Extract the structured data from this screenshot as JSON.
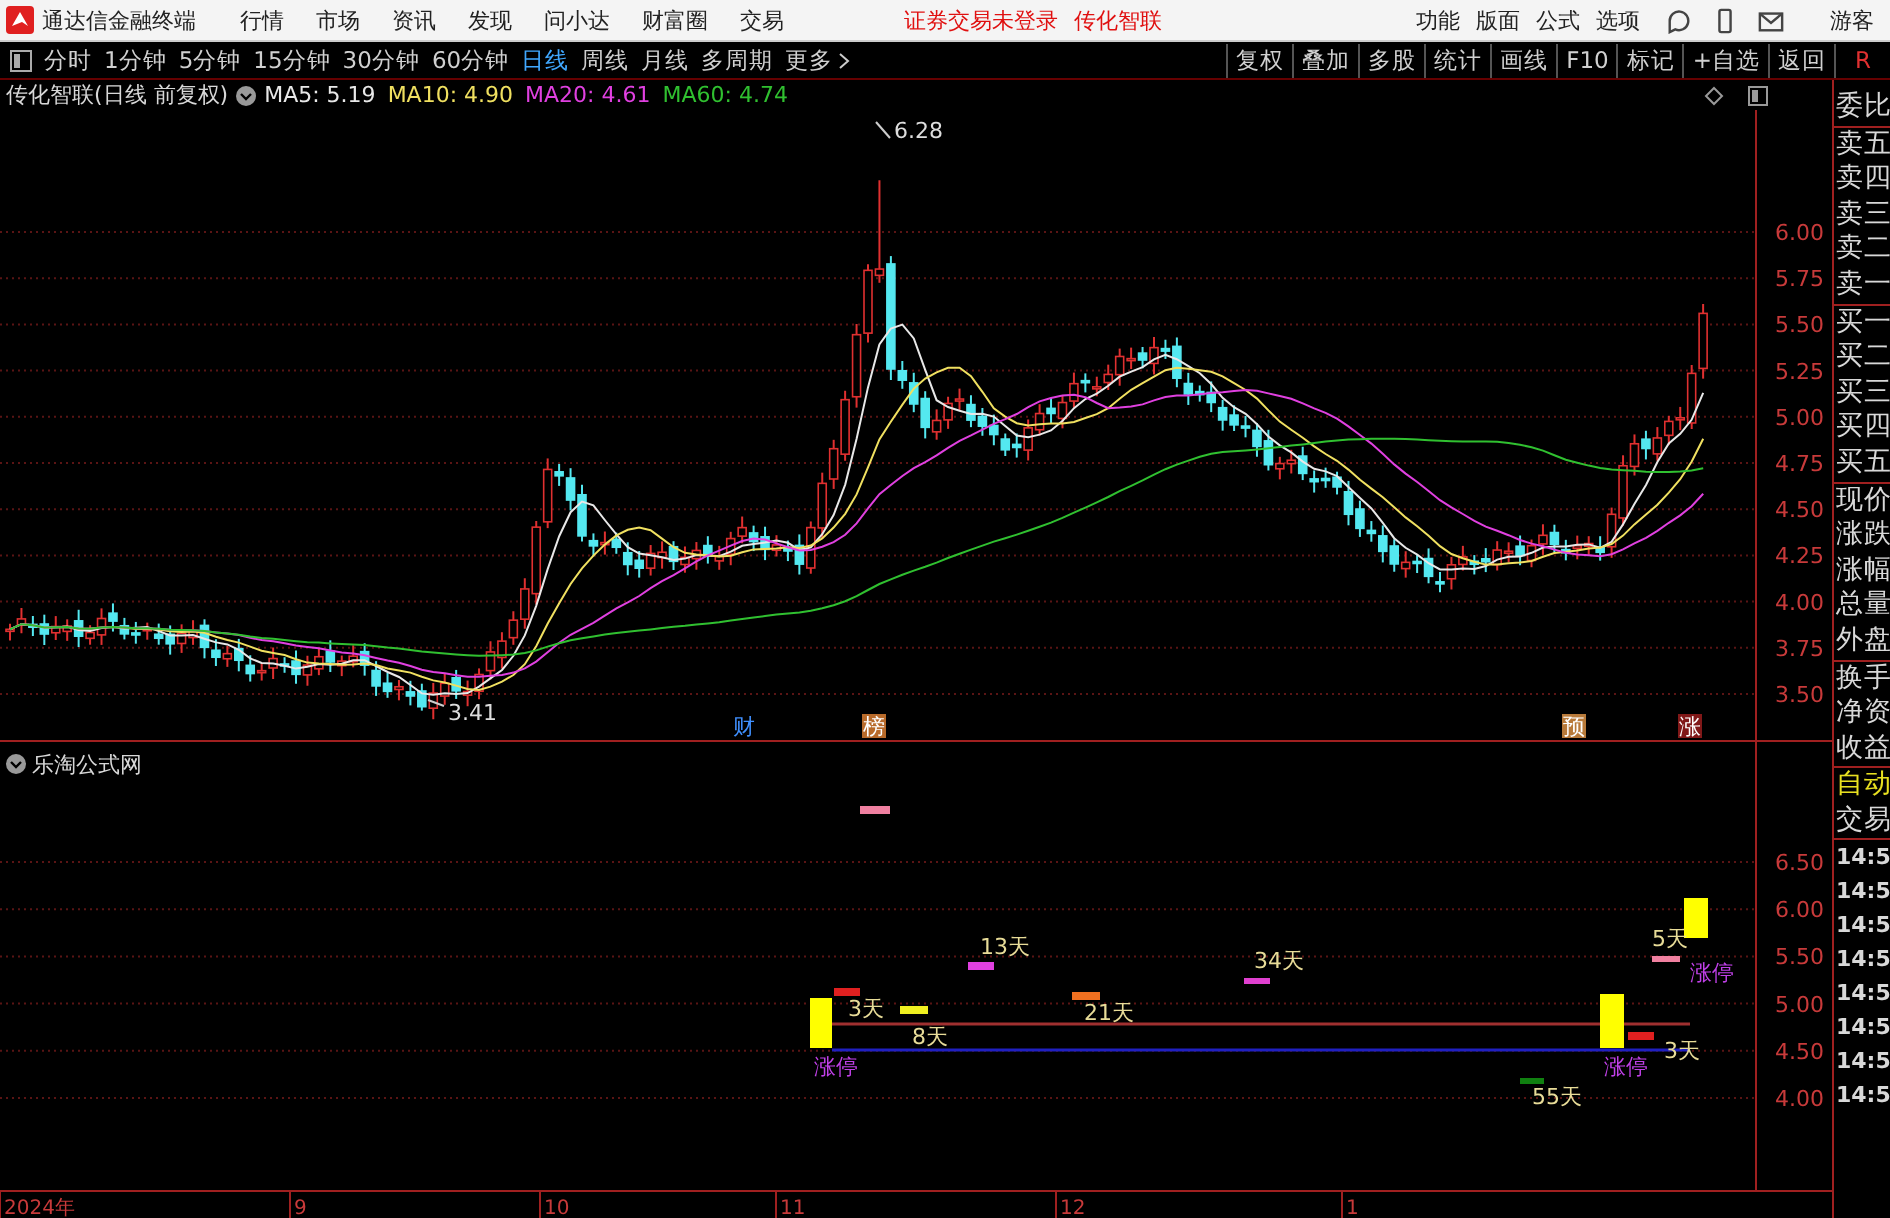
{
  "title_bar": {
    "app_name": "通达信金融终端",
    "menu": [
      "行情",
      "市场",
      "资讯",
      "发现",
      "问小达",
      "财富圈",
      "交易"
    ],
    "status": [
      "证券交易未登录",
      "传化智联"
    ],
    "tools": [
      "功能",
      "版面",
      "公式",
      "选项"
    ],
    "user": "游客"
  },
  "toolbar": {
    "periods": [
      {
        "label": "分时",
        "selected": false
      },
      {
        "label": "1分钟",
        "selected": false
      },
      {
        "label": "5分钟",
        "selected": false
      },
      {
        "label": "15分钟",
        "selected": false
      },
      {
        "label": "30分钟",
        "selected": false
      },
      {
        "label": "60分钟",
        "selected": false
      },
      {
        "label": "日线",
        "selected": true
      },
      {
        "label": "周线",
        "selected": false
      },
      {
        "label": "月线",
        "selected": false
      },
      {
        "label": "多周期",
        "selected": false
      },
      {
        "label": "更多",
        "selected": false
      }
    ],
    "actions": [
      "复权",
      "叠加",
      "多股",
      "统计",
      "画线",
      "F10",
      "标记",
      "+自选",
      "返回"
    ],
    "corner": "R"
  },
  "chart_header": {
    "title": "传化智联(日线 前复权)",
    "indicators": [
      {
        "label": "MA5: 5.19",
        "color": "#e8e8e8"
      },
      {
        "label": "MA10: 4.90",
        "color": "#f0e060"
      },
      {
        "label": "MA20: 4.61",
        "color": "#e040e0"
      },
      {
        "label": "MA60: 4.74",
        "color": "#30c030"
      }
    ]
  },
  "main_chart": {
    "price_axis": [
      "6.00",
      "5.75",
      "5.50",
      "5.25",
      "5.00",
      "4.75",
      "4.50",
      "4.25",
      "4.00",
      "3.75",
      "3.50"
    ],
    "high_label": "6.28",
    "low_label": "3.41",
    "event_marks": [
      {
        "text": "财",
        "kind": "finance"
      },
      {
        "text": "榜",
        "kind": "ranking"
      },
      {
        "text": "预",
        "kind": "forecast"
      },
      {
        "text": "涨",
        "kind": "rise"
      }
    ]
  },
  "indicator_panel": {
    "title": "乐淘公式网",
    "price_axis": [
      "6.50",
      "6.00",
      "5.50",
      "5.00",
      "4.50",
      "4.00"
    ],
    "labels": [
      {
        "text": "3天",
        "kind": "days"
      },
      {
        "text": "8天",
        "kind": "days"
      },
      {
        "text": "13天",
        "kind": "days"
      },
      {
        "text": "21天",
        "kind": "days"
      },
      {
        "text": "34天",
        "kind": "days"
      },
      {
        "text": "55天",
        "kind": "days"
      },
      {
        "text": "3天",
        "kind": "days"
      },
      {
        "text": "5天",
        "kind": "days"
      },
      {
        "text": "涨停",
        "kind": "limit_up"
      },
      {
        "text": "涨停",
        "kind": "limit_up"
      },
      {
        "text": "涨停",
        "kind": "limit_up"
      }
    ]
  },
  "date_axis": [
    "2024年",
    "9",
    "10",
    "11",
    "12",
    "1"
  ],
  "quote_panel": {
    "fields": [
      "委比",
      "卖五",
      "卖四",
      "卖三",
      "卖二",
      "卖一",
      "买一",
      "买二",
      "买三",
      "买四",
      "买五",
      "现价",
      "涨跌",
      "涨幅",
      "总量",
      "外盘",
      "换手",
      "净资",
      "收益"
    ],
    "auto_trade": [
      "自动",
      "交易"
    ],
    "times": [
      "14:5",
      "14:5",
      "14:5",
      "14:5",
      "14:5",
      "14:5",
      "14:5",
      "14:5"
    ]
  }
}
